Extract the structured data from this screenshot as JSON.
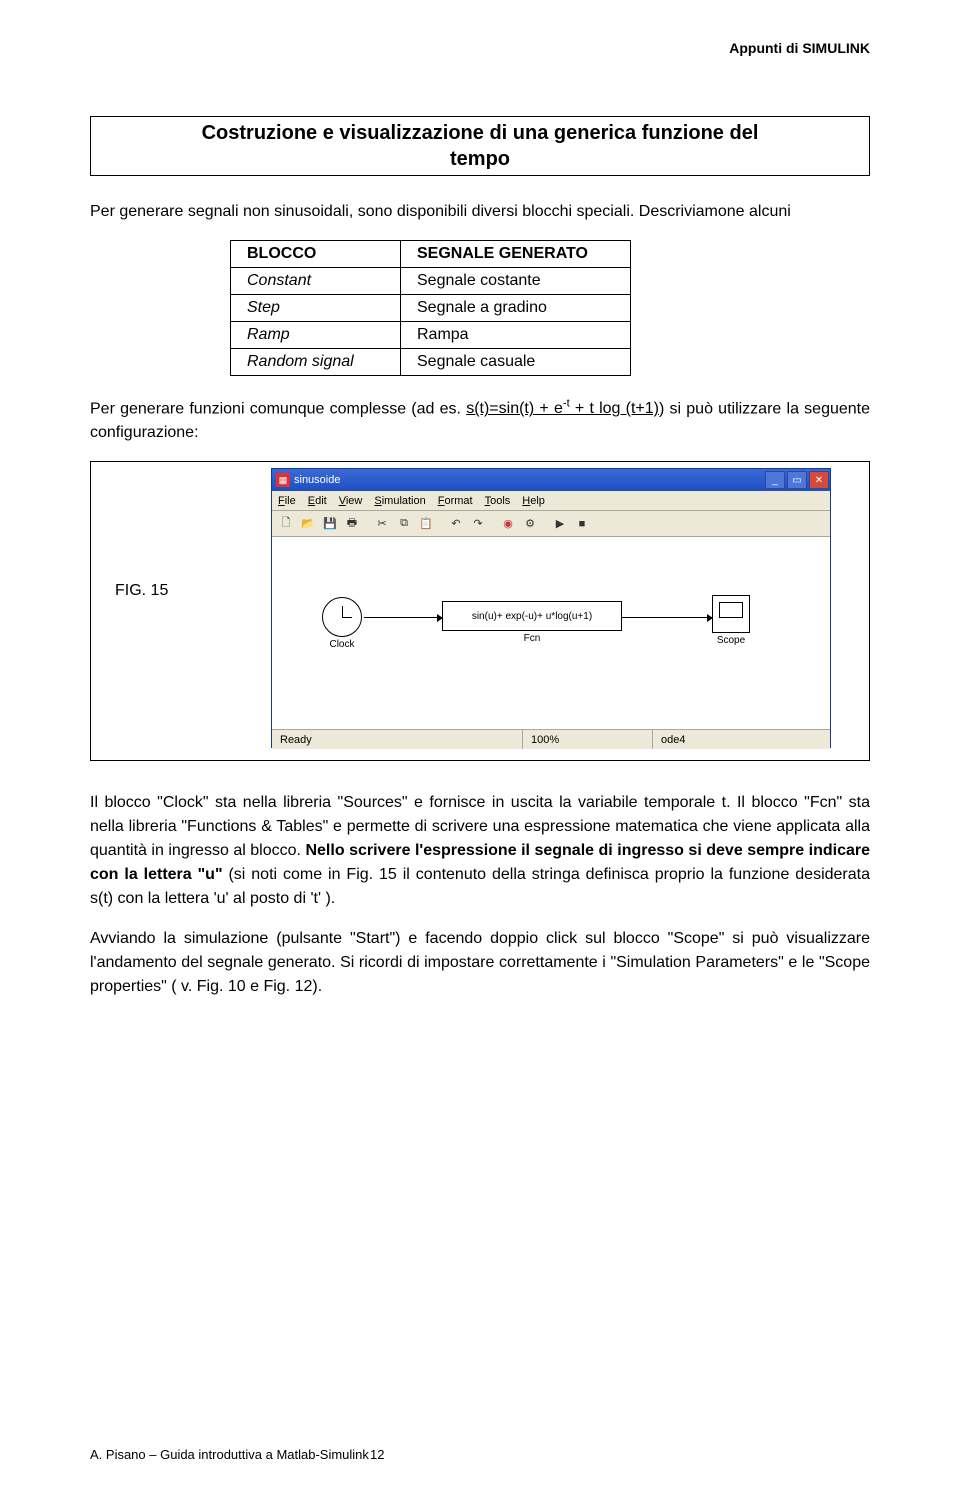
{
  "header": {
    "right": "Appunti di SIMULINK"
  },
  "section_title": {
    "line1": "Costruzione e visualizzazione di una generica funzione del",
    "line2": "tempo"
  },
  "para1": "Per generare segnali non sinusoidali, sono disponibili diversi blocchi speciali. Descriviamone alcuni",
  "table": {
    "h1": "BLOCCO",
    "h2": "SEGNALE GENERATO",
    "rows": [
      {
        "c1": "Constant",
        "c2": "Segnale costante"
      },
      {
        "c1": "Step",
        "c2": "Segnale a gradino"
      },
      {
        "c1": "Ramp",
        "c2": "Rampa"
      },
      {
        "c1": "Random signal",
        "c2": "Segnale casuale"
      }
    ]
  },
  "para2_a": "Per generare funzioni comunque complesse (ad es. ",
  "para2_u": "s(t)=sin(t) + e",
  "para2_sup": "-t",
  "para2_u2": " + t log (t+1)",
  "para2_b": ") si può utilizzare la seguente configurazione:",
  "fig": {
    "label": "FIG. 15",
    "win_title": "sinusoide",
    "menubar": {
      "file": "File",
      "edit": "Edit",
      "view": "View",
      "simulation": "Simulation",
      "format": "Format",
      "tools": "Tools",
      "help": "Help"
    },
    "status": {
      "ready": "Ready",
      "pct": "100%",
      "solver": "ode4"
    },
    "blocks": {
      "clock": "Clock",
      "fcn_label": "Fcn",
      "fcn_expr": "sin(u)+ exp(-u)+ u*log(u+1)",
      "scope": "Scope"
    }
  },
  "para3_a": "Il blocco \"Clock\" sta nella libreria \"Sources\" e fornisce in uscita la variabile temporale t. Il blocco \"Fcn\" sta nella libreria \"Functions & Tables\" e permette di scrivere una espressione matematica che viene applicata alla quantità in ingresso al blocco. ",
  "para3_bold": "Nello scrivere l'espressione il segnale di ingresso si deve sempre indicare con la lettera \"u\"",
  "para3_b": " (si noti come in Fig. 15 il contenuto della stringa definisca proprio la funzione desiderata s(t) con la lettera 'u' al posto di 't' ).",
  "para4": "Avviando la simulazione (pulsante \"Start\") e facendo doppio click sul blocco \"Scope\" si può visualizzare l'andamento del segnale generato. Si ricordi di impostare correttamente i \"Simulation Parameters\" e le \"Scope properties\" ( v. Fig. 10 e Fig. 12).",
  "footer": {
    "text": "A. Pisano – Guida introduttiva a Matlab-Simulink",
    "page": "12"
  }
}
